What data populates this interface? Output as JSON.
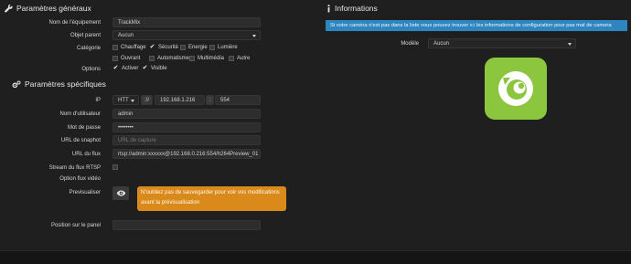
{
  "general": {
    "title": "Paramètres généraux",
    "equipment_name_label": "Nom de l'équipement",
    "equipment_name_value": "TrackMix",
    "parent_label": "Objet parent",
    "parent_value": "Aucun",
    "category_label": "Catégorie",
    "categories": [
      "Chauffage",
      "Sécurité",
      "Energie",
      "Lumière",
      "Ouvrant",
      "Automatisme",
      "Multimédia",
      "Autre"
    ],
    "options_label": "Options",
    "option_enable": "Activer",
    "option_visible": "Visible"
  },
  "specific": {
    "title": "Paramètres spécifiques",
    "ip_label": "IP",
    "protocol_value": "HTT",
    "separator": "://",
    "ip_value": "192.168.1.216",
    "colon": ":",
    "port_value": "554",
    "username_label": "Nom d'utilisateur",
    "username_value": "admin",
    "password_label": "Mot de passe",
    "password_value": "••••••••",
    "snapshot_label": "URL de snaphot",
    "snapshot_placeholder": "URL de capture",
    "stream_label": "URL du flux",
    "stream_value": "rtsp://admin:xxxxxx@192.168.0.216:554/h264Preview_01",
    "rtsp_label": "Stream du flux RTSP",
    "video_option_label": "Option flux vidéo",
    "preview_label": "Previsualiser",
    "warning_line1": "N'oubliez pas de sauvegarder pour voir vos modifications",
    "warning_line2": "avant la prévisualisation",
    "panel_position_label": "Position sur le panel"
  },
  "informations": {
    "title": "Informations",
    "banner_part1": "Si votre caméra n'est pas dans la liste vous pouvez trouver",
    "banner_link": "ici",
    "banner_part2": "les informations de configuration pour pas mal de camera",
    "model_label": "Modèle",
    "model_value": "Aucun"
  },
  "colors": {
    "info_banner": "#2e86c1",
    "warning": "#d98a1b",
    "logo_green": "#8cc63f"
  }
}
